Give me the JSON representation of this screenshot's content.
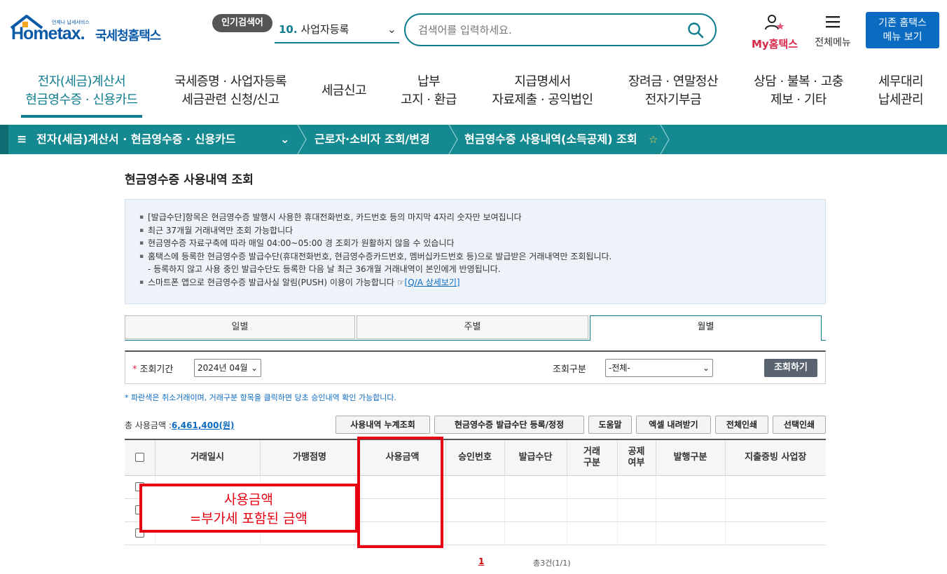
{
  "header": {
    "logo_small": "언제나 납세서비스",
    "logo_brand": "Hometax.",
    "logo_kr": "국세청홈택스",
    "popular_badge": "인기검색어",
    "popular_rank": "10.",
    "popular_term": "사업자등록",
    "search_placeholder": "검색어를 입력하세요.",
    "my_hometax": "My홈택스",
    "all_menu": "전체메뉴",
    "old_menu_line1": "기존 홈택스",
    "old_menu_line2": "메뉴 보기"
  },
  "gnb": {
    "items": [
      {
        "line1": "전자(세금)계산서",
        "line2": "현금영수증 · 신용카드"
      },
      {
        "line1": "국세증명 · 사업자등록",
        "line2": "세금관련 신청/신고"
      },
      {
        "line1": "세금신고",
        "line2": ""
      },
      {
        "line1": "납부",
        "line2": "고지 · 환급"
      },
      {
        "line1": "지급명세서",
        "line2": "자료제출 · 공익법인"
      },
      {
        "line1": "장려금 · 연말정산",
        "line2": "전자기부금"
      },
      {
        "line1": "상담 · 불복 · 고충",
        "line2": "제보 · 기타"
      },
      {
        "line1": "세무대리",
        "line2": "납세관리"
      }
    ]
  },
  "breadcrumb": {
    "level1": "전자(세금)계산서 · 현금영수증 · 신용카드",
    "level2": "근로자·소비자 조회/변경",
    "level3": "현금영수증 사용내역(소득공제) 조회"
  },
  "page": {
    "title": "현금영수증 사용내역 조회",
    "notices": [
      "[발급수단]항목은 현금영수증 발행시 사용한 휴대전화번호, 카드번호 등의 마지막 4자리 숫자만 보여집니다",
      "최근 37개월 거래내역만 조회 가능합니다",
      "현금영수증 자료구축에 따라 매일 04:00~05:00 경 조회가 원활하지 않을 수 있습니다",
      "홈택스에 등록한 현금영수증 발급수단(휴대전화번호, 현금영수증카드번호, 멤버십카드번호 등)으로 발급받은 거래내역만 조회됩니다.",
      "- 등록하지 않고 사용 중인 발급수단도 등록한 다음 날 최근 36개월 거래내역이 본인에게 반영됩니다.",
      "스마트폰 앱으로 현금영수증 발급사실 알림(PUSH) 이용이 가능합니다 ☞"
    ],
    "qa_link": "[Q/A 상세보기]",
    "tabs": [
      "일별",
      "주별",
      "월별"
    ],
    "active_tab": "월별",
    "filter": {
      "period_label": "조회기간",
      "period_value": "2024년 04월",
      "kind_label": "조회구분",
      "kind_value": "-전체-",
      "search_button": "조회하기"
    },
    "hint": "* 파란색은 취소거래이며, 거래구분 항목을 클릭하면 당초 승인내역 확인 가능합니다.",
    "total_label": "총 사용금액 :",
    "total_amount": "6,461,400(원)",
    "buttons": [
      "사용내역 누계조회",
      "현금영수증 발급수단 등록/정정",
      "도움말",
      "엑셀 내려받기",
      "전체인쇄",
      "선택인쇄"
    ],
    "columns": [
      "거래일시",
      "가맹점명",
      "사용금액",
      "승인번호",
      "발급수단",
      "거래\n구분",
      "공제\n여부",
      "발행구분",
      "지출증빙 사업장"
    ],
    "annotation_line1": "사용금액",
    "annotation_line2": "=부가세 포함된 금액",
    "pager_current": "1",
    "count_text": "총3건(1/1)"
  }
}
